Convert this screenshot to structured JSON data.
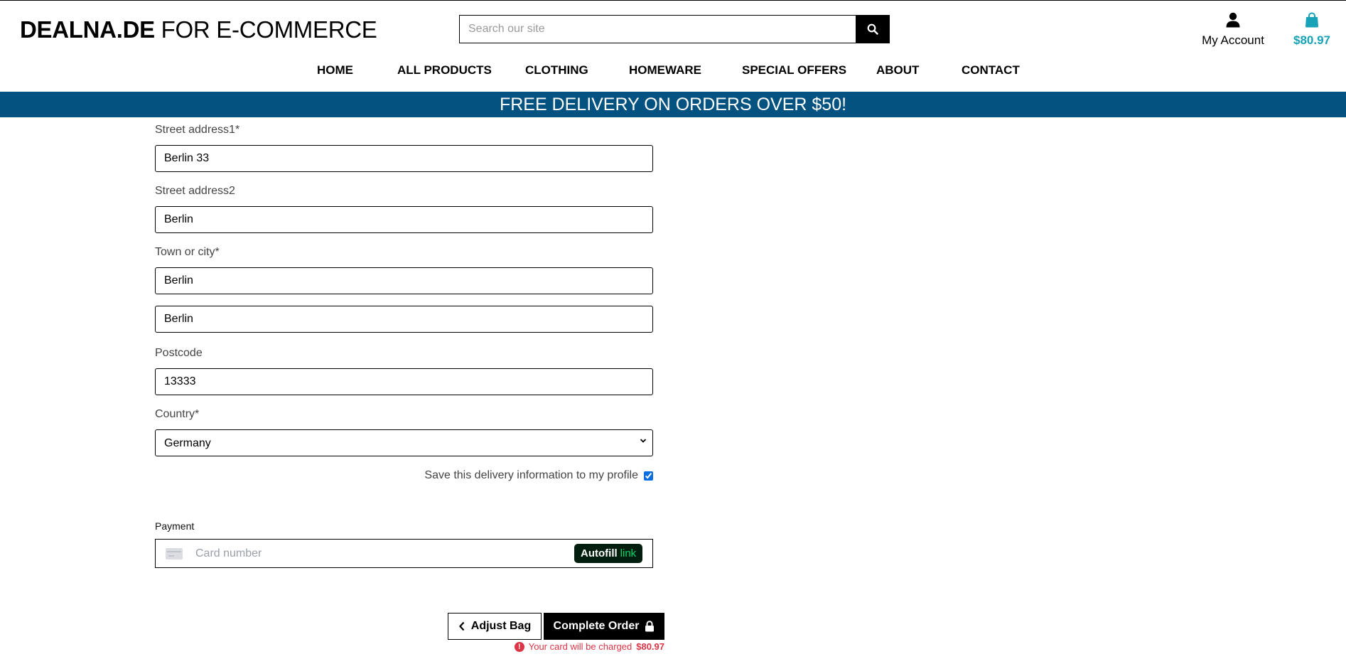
{
  "header": {
    "logo_bold": "DEALNA.DE",
    "logo_rest": " FOR E-COMMERCE",
    "search_placeholder": "Search our site",
    "account_label": "My Account",
    "bag_total": "$80.97"
  },
  "nav": {
    "items": [
      "HOME",
      "ALL PRODUCTS",
      "CLOTHING",
      "HOMEWARE",
      "SPECIAL OFFERS",
      "ABOUT",
      "CONTACT"
    ]
  },
  "banner": {
    "text": "FREE DELIVERY ON ORDERS OVER $50!"
  },
  "form": {
    "street1_label": "Street address1*",
    "street1_value": "Berlin 33",
    "street2_label": "Street address2",
    "street2_value": "Berlin",
    "town_label": "Town or city*",
    "town_value": "Berlin",
    "county_value": "Berlin",
    "postcode_label": "Postcode",
    "postcode_value": "13333",
    "country_label": "Country*",
    "country_value": "Germany",
    "save_label": "Save this delivery information to my profile",
    "save_checked": true
  },
  "payment": {
    "label": "Payment",
    "card_placeholder": "Card number",
    "autofill_text": "Autofill",
    "autofill_link": "link"
  },
  "actions": {
    "adjust_label": "Adjust Bag",
    "complete_label": "Complete Order",
    "charge_text": "Your card will be charged",
    "charge_amount": "$80.97"
  },
  "colors": {
    "banner_bg": "#03527f",
    "bag_accent": "#17a2b8",
    "warning": "#dc3545",
    "autofill_bg": "#011e0f",
    "autofill_link": "#00d66f"
  },
  "icons": [
    "search-icon",
    "user-icon",
    "shopping-bag-icon",
    "chevron-left-icon",
    "lock-icon",
    "card-icon",
    "exclamation-circle-icon",
    "chevron-down-icon"
  ]
}
